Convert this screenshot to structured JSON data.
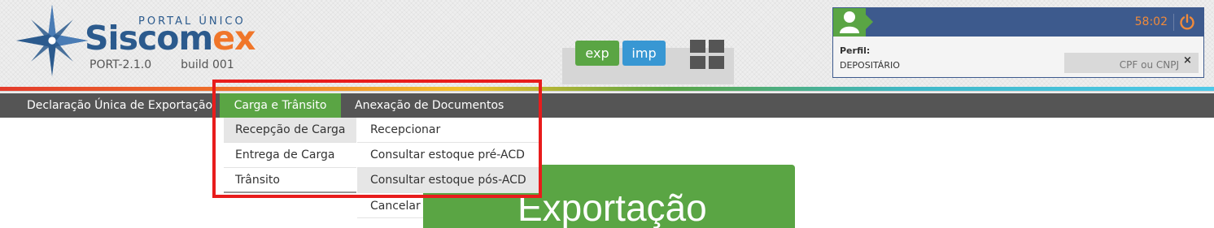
{
  "header": {
    "portal_text": "PORTAL ÚNICO",
    "brand_part1": "Siscom",
    "brand_part2": "ex",
    "version": "PORT-2.1.0",
    "build": "build 001"
  },
  "modules": {
    "exp_label": "exp",
    "imp_label": "imp"
  },
  "user": {
    "timer": "58:02",
    "perfil_label": "Perfil:",
    "perfil_value": "DEPOSITÁRIO",
    "cpf_placeholder": "CPF ou CNPJ",
    "clear_label": "×"
  },
  "menu": {
    "items": [
      {
        "label": "Declaração Única de Exportação"
      },
      {
        "label": "Carga e Trânsito"
      },
      {
        "label": "Anexação de Documentos"
      }
    ]
  },
  "dropdown": {
    "col1": [
      {
        "label": "Recepção de Carga"
      },
      {
        "label": "Entrega de Carga"
      },
      {
        "label": "Trânsito"
      }
    ],
    "col2": [
      {
        "label": "Recepcionar"
      },
      {
        "label": "Consultar estoque pré-ACD"
      },
      {
        "label": "Consultar estoque pós-ACD"
      },
      {
        "label": "Cancelar"
      }
    ]
  },
  "panel": {
    "title": "Exportação"
  },
  "colors": {
    "menu_bar": "#555555",
    "green": "#5aa544",
    "blue": "#3897d3",
    "navy": "#3d5a8d",
    "orange": "#f0762a",
    "highlight": "#e81c1c"
  },
  "icons": [
    "compass-star-logo-icon",
    "grid-apps-icon",
    "user-avatar-icon",
    "power-icon",
    "close-icon"
  ]
}
